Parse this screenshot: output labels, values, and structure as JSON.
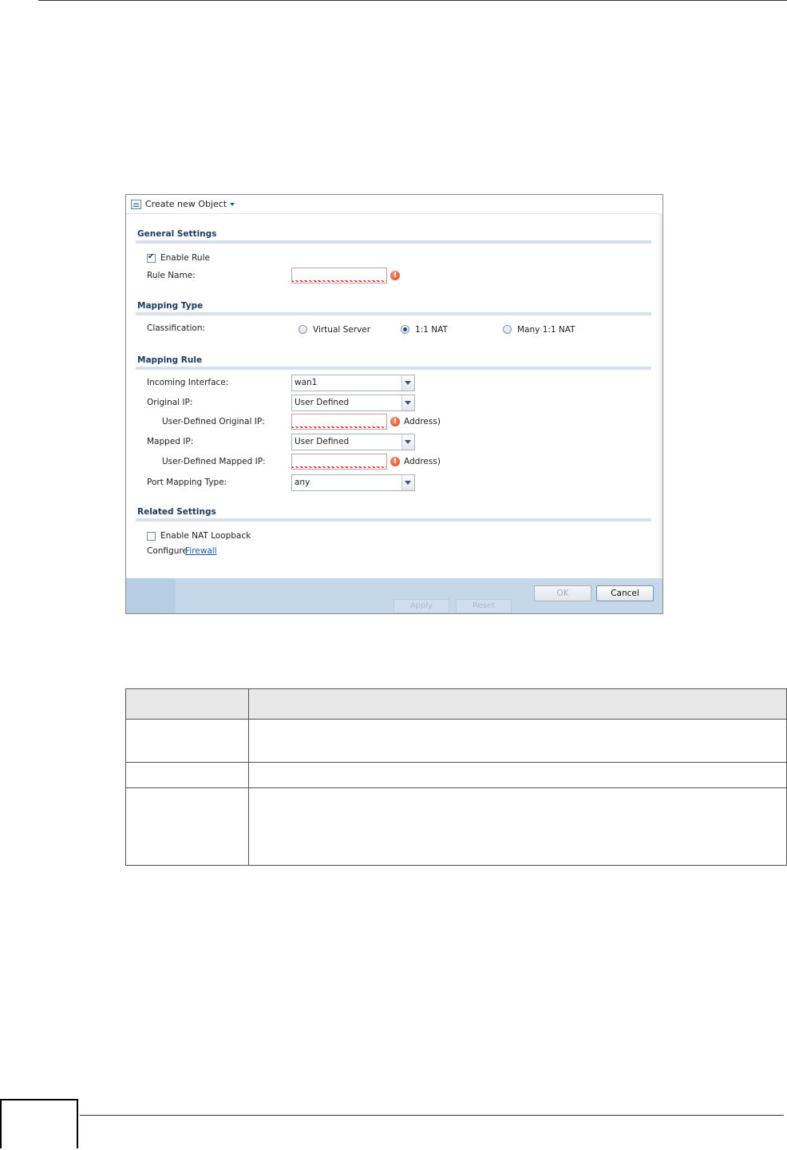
{
  "toolbar": {
    "create_label": "Create new Object"
  },
  "general": {
    "title": "General Settings",
    "enable_rule_label": "Enable Rule",
    "enable_rule_checked": true,
    "rule_name_label": "Rule Name:",
    "rule_name_value": ""
  },
  "mapping_type": {
    "title": "Mapping Type",
    "classification_label": "Classification:",
    "options": [
      "Virtual Server",
      "1:1 NAT",
      "Many 1:1 NAT"
    ],
    "selected": "1:1 NAT"
  },
  "mapping_rule": {
    "title": "Mapping Rule",
    "incoming_interface_label": "Incoming Interface:",
    "incoming_interface_value": "wan1",
    "original_ip_label": "Original IP:",
    "original_ip_value": "User Defined",
    "user_defined_original_ip_label": "User-Defined Original IP:",
    "user_defined_original_ip_suffix": "Address)",
    "mapped_ip_label": "Mapped IP:",
    "mapped_ip_value": "User Defined",
    "user_defined_mapped_ip_label": "User-Defined Mapped IP:",
    "user_defined_mapped_ip_suffix": "Address)",
    "port_mapping_type_label": "Port Mapping Type:",
    "port_mapping_type_value": "any"
  },
  "related": {
    "title": "Related Settings",
    "nat_loopback_label": "Enable NAT Loopback",
    "nat_loopback_checked": false,
    "configure_label": "Configure",
    "firewall_link": "Firewall"
  },
  "footer": {
    "ghost_apply": "Apply",
    "ghost_reset": "Reset",
    "ok_label": "OK",
    "cancel_label": "Cancel"
  },
  "colors": {
    "section_title": "#1f3a60",
    "footer_bg": "#c4d8ea",
    "link": "#1a57a8",
    "warning": "#d34420"
  },
  "icons": [
    "create-object-icon",
    "chevron-down-icon",
    "warning-icon",
    "checkbox-icon",
    "radio-icon"
  ]
}
